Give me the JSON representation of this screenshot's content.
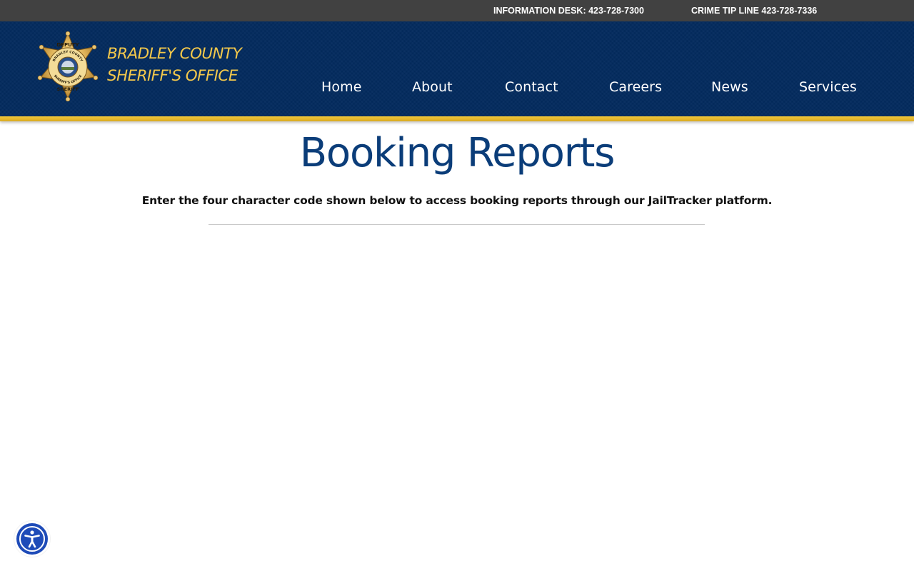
{
  "topbar": {
    "info_desk": "INFORMATION DESK: 423-728-7300",
    "crime_tip": "CRIME TIP LINE 423-728-7336"
  },
  "brand": {
    "line1": "BRADLEY COUNTY",
    "line2": "SHERIFF'S OFFICE",
    "badge_text": {
      "top": "DEPUTY",
      "ring_top": "BRADLEY COUNTY",
      "ring_bottom": "SHERIFF'S OFFICE",
      "bottom": "SHERIFF"
    }
  },
  "nav": {
    "items": [
      "Home",
      "About",
      "Contact",
      "Careers",
      "News",
      "Services"
    ]
  },
  "main": {
    "title": "Booking Reports",
    "instructions": "Enter the four character code shown below to access booking reports through our JailTracker platform."
  },
  "icons": {
    "badge": "sheriff-star-badge-icon",
    "accessibility": "accessibility-person-icon"
  },
  "colors": {
    "topbar_bg": "#414141",
    "header_bg": "#032b5e",
    "accent_gold": "#f1c83a",
    "title_blue": "#0b3d79",
    "accessibility_blue": "#1e4bb8"
  }
}
